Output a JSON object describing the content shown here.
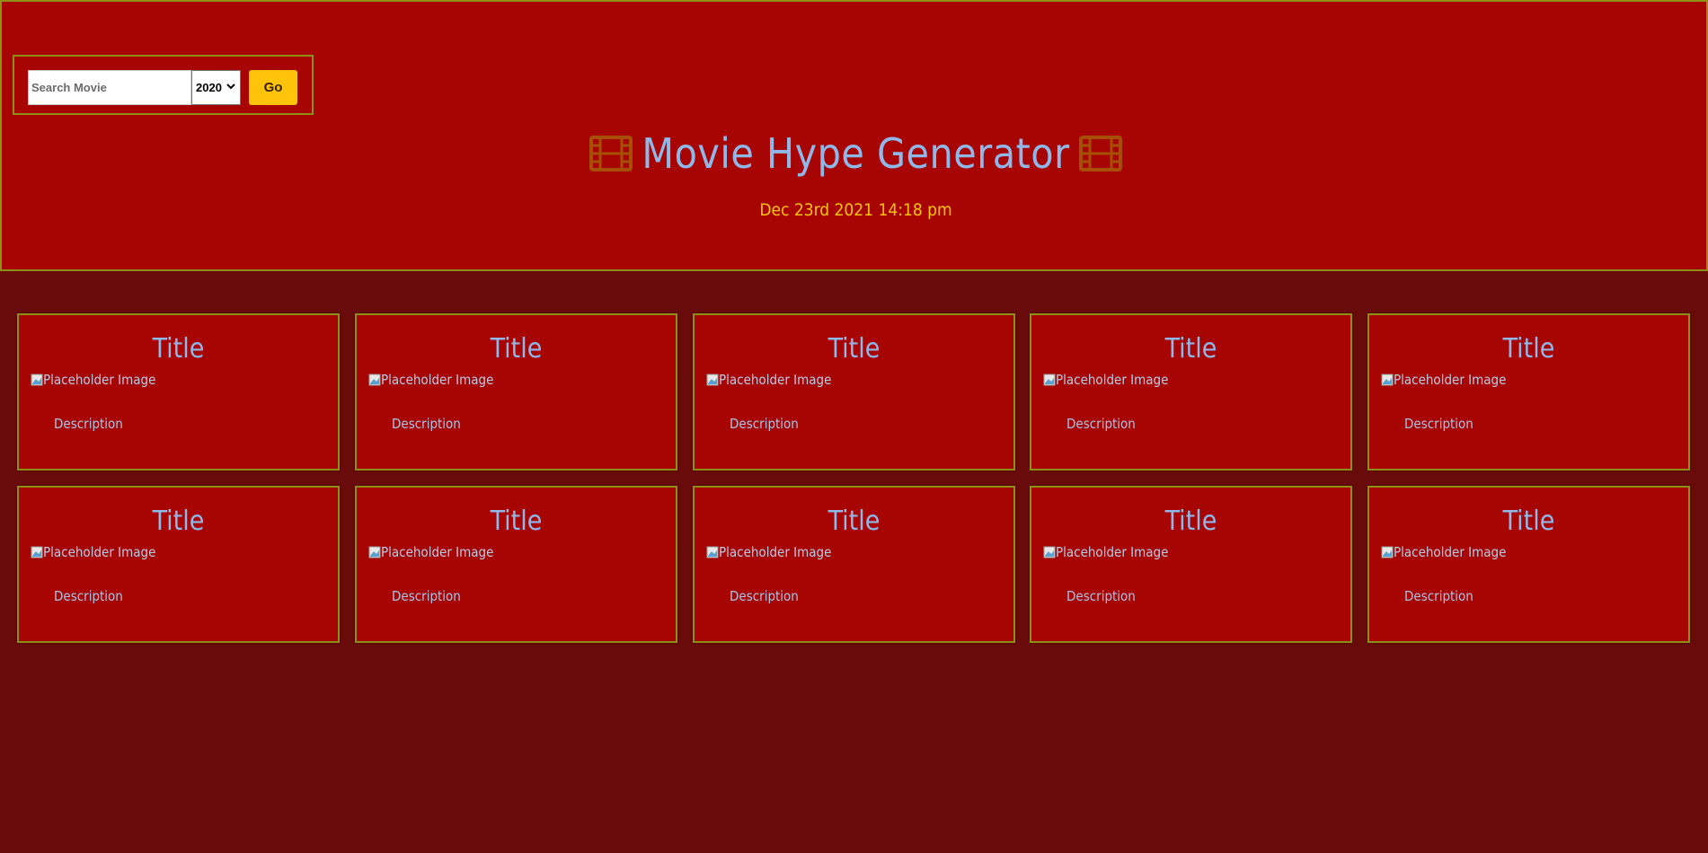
{
  "search": {
    "placeholder": "Search Movie",
    "value": "",
    "year_selected": "2020",
    "go_label": "Go"
  },
  "header": {
    "title": "Movie Hype Generator",
    "left_icon": "film-icon",
    "right_icon": "film-icon",
    "datetime": "Dec 23rd 2021 14:18 pm"
  },
  "cards": [
    {
      "title": "Title",
      "image_alt": "Placeholder Image",
      "description": "Description"
    },
    {
      "title": "Title",
      "image_alt": "Placeholder Image",
      "description": "Description"
    },
    {
      "title": "Title",
      "image_alt": "Placeholder Image",
      "description": "Description"
    },
    {
      "title": "Title",
      "image_alt": "Placeholder Image",
      "description": "Description"
    },
    {
      "title": "Title",
      "image_alt": "Placeholder Image",
      "description": "Description"
    },
    {
      "title": "Title",
      "image_alt": "Placeholder Image",
      "description": "Description"
    },
    {
      "title": "Title",
      "image_alt": "Placeholder Image",
      "description": "Description"
    },
    {
      "title": "Title",
      "image_alt": "Placeholder Image",
      "description": "Description"
    },
    {
      "title": "Title",
      "image_alt": "Placeholder Image",
      "description": "Description"
    },
    {
      "title": "Title",
      "image_alt": "Placeholder Image",
      "description": "Description"
    }
  ],
  "colors": {
    "page_background": "#6a0b0b",
    "header_background": "#a70404",
    "border": "#8f8f16",
    "title_text": "#8fb7e8",
    "accent_yellow": "#ffc40a",
    "film_icon": "#a74f06"
  }
}
